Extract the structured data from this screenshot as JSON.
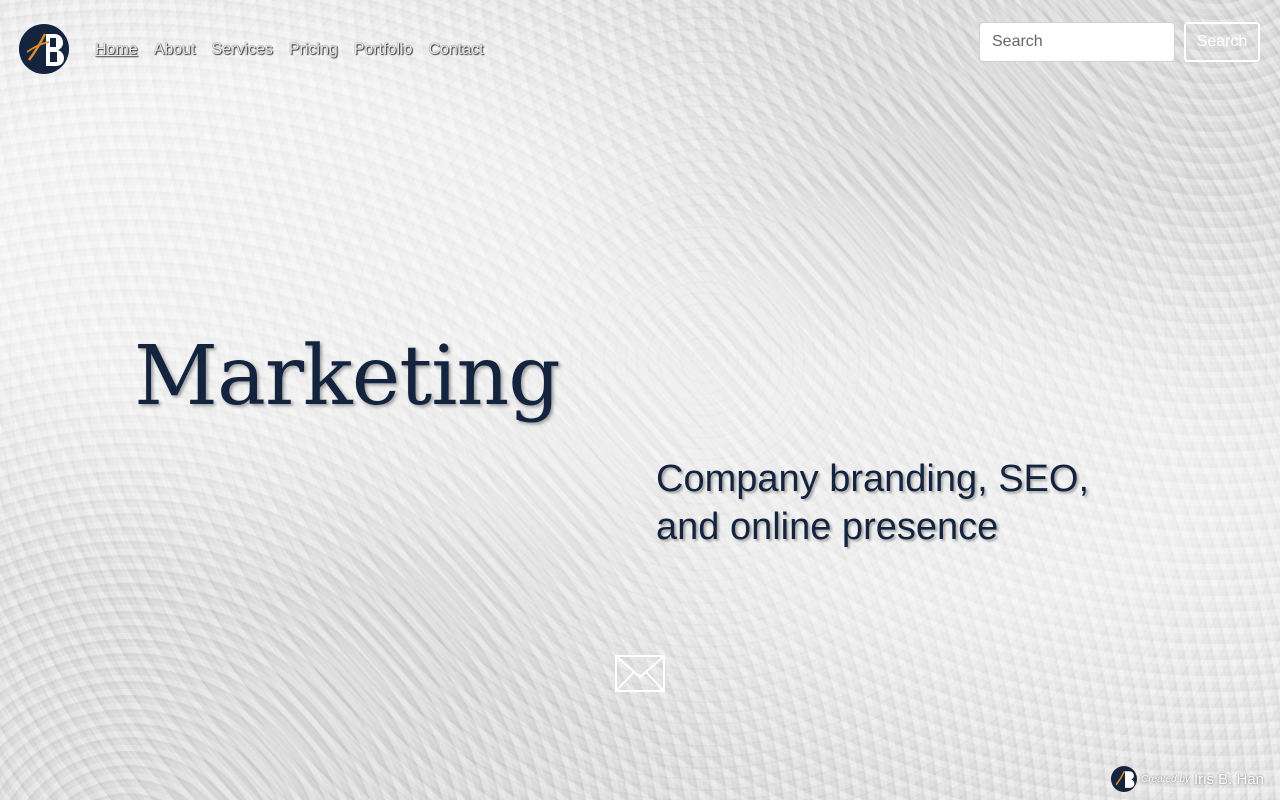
{
  "nav": {
    "items": [
      {
        "label": "Home",
        "active": true
      },
      {
        "label": "About"
      },
      {
        "label": "Services"
      },
      {
        "label": "Pricing"
      },
      {
        "label": "Portfolio"
      },
      {
        "label": "Contact"
      }
    ]
  },
  "search": {
    "placeholder": "Search",
    "value": "",
    "button_label": "Search"
  },
  "hero": {
    "title": "Marketing",
    "subtitle": "Company branding, SEO, and online presence"
  },
  "footer": {
    "credit_prefix": "Created by",
    "credit_name": "Iris B. Han"
  },
  "icons": {
    "logo": "ib-monogram-logo",
    "mail": "envelope-icon"
  },
  "colors": {
    "navy": "#14243e",
    "accent": "#e08a2a"
  }
}
